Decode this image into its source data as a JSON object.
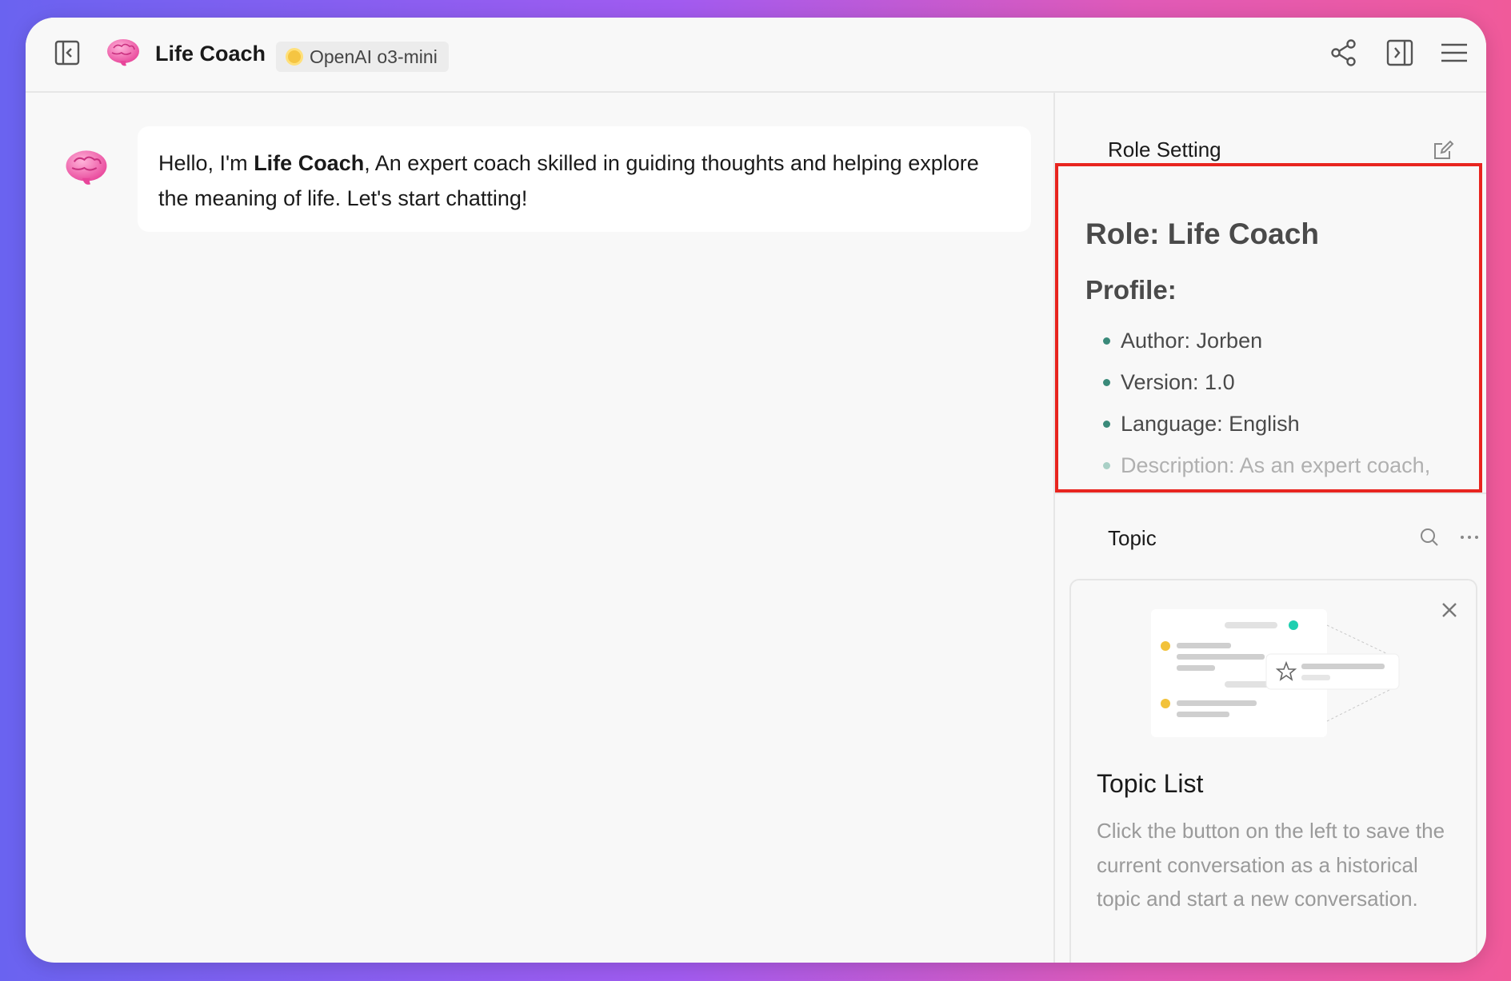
{
  "header": {
    "title": "Life Coach",
    "model": "OpenAI o3-mini",
    "icons": [
      "sidebar-toggle-left-icon",
      "brain-avatar-icon",
      "openai-icon",
      "share-icon",
      "sidebar-toggle-right-icon",
      "menu-icon"
    ]
  },
  "chat": {
    "messages": [
      {
        "role": "assistant",
        "greeting": "Hello, I'm ",
        "name": "Life Coach",
        "rest": ", An expert coach skilled in guiding thoughts and helping explore the meaning of life. Let's start chatting!"
      }
    ]
  },
  "side": {
    "role_setting": {
      "title": "Role Setting",
      "heading": "Role: Life Coach",
      "subheading": "Profile:",
      "items": [
        "Author: Jorben",
        "Version: 1.0",
        "Language: English",
        "Description: As an expert coach,"
      ]
    },
    "topic": {
      "title": "Topic",
      "card_title": "Topic List",
      "card_desc": "Click the button on the left to save the current conversation as a historical topic and start a new conversation."
    }
  },
  "colors": {
    "highlight_border": "#e8251f",
    "bullet": "#3a8a7a",
    "model_badge_bg": "#ececec"
  }
}
